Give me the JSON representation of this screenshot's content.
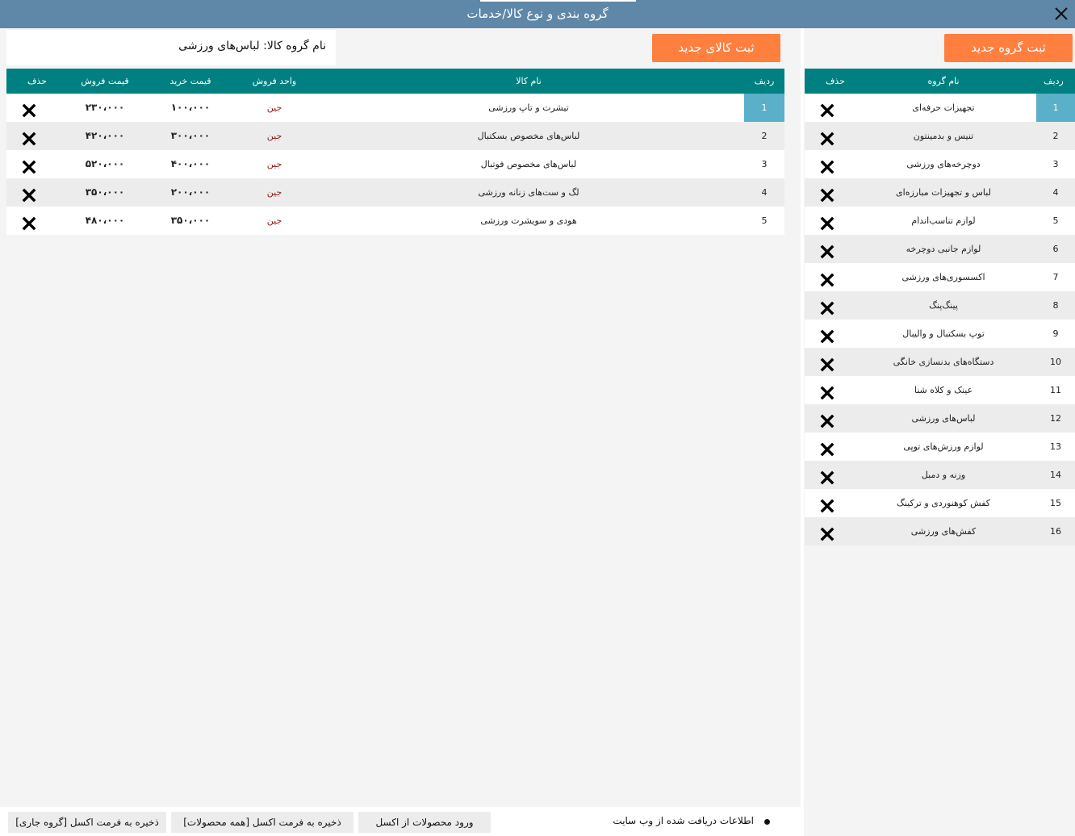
{
  "window": {
    "title": "گروه بندی و نوع کالا/خدمات"
  },
  "buttons": {
    "new_group": "ثبت گروه جدید",
    "new_product": "ثبت کالای جدید",
    "import_excel": "ورود محصولات از اکسل",
    "export_all": "ذخیره به فرمت اکسل [همه محصولات]",
    "export_current": "ذخیره به فرمت اکسل [گروه جاری]"
  },
  "current_group_label": "نام گروه کالا: لباس‌های ورزشی",
  "status": {
    "text": "اطلاعات دریافت شده از وب سایت"
  },
  "products": {
    "headers": {
      "row": "ردیف",
      "name": "نام کالا",
      "unit": "واحد فروش",
      "buy": "قیمت خرید",
      "sell": "قیمت فروش",
      "delete": "حذف"
    },
    "rows": [
      {
        "row": "1",
        "name": "تیشرت و تاپ ورزشی",
        "unit": "جین",
        "buy": "۱۰۰،۰۰۰",
        "sell": "۲۳۰،۰۰۰",
        "selected": true
      },
      {
        "row": "2",
        "name": "لباس‌های مخصوص بسکتبال",
        "unit": "جین",
        "buy": "۳۰۰،۰۰۰",
        "sell": "۴۲۰،۰۰۰"
      },
      {
        "row": "3",
        "name": "لباس‌های مخصوص فوتبال",
        "unit": "جین",
        "buy": "۴۰۰،۰۰۰",
        "sell": "۵۲۰،۰۰۰"
      },
      {
        "row": "4",
        "name": "لگ و ست‌های زنانه ورزشی",
        "unit": "جین",
        "buy": "۲۰۰،۰۰۰",
        "sell": "۳۵۰،۰۰۰"
      },
      {
        "row": "5",
        "name": "هودی و سویشرت ورزشی",
        "unit": "جین",
        "buy": "۳۵۰،۰۰۰",
        "sell": "۴۸۰،۰۰۰"
      }
    ]
  },
  "groups": {
    "headers": {
      "row": "ردیف",
      "name": "نام گروه",
      "delete": "حذف"
    },
    "rows": [
      {
        "row": "1",
        "name": "تجهیزات حرفه‌ای",
        "selected": true
      },
      {
        "row": "2",
        "name": "تنیس و بدمینتون"
      },
      {
        "row": "3",
        "name": "دوچرخه‌های ورزشی"
      },
      {
        "row": "4",
        "name": "لباس و تجهیزات مبارزه‌ای"
      },
      {
        "row": "5",
        "name": "لوازم تناسب‌اندام"
      },
      {
        "row": "6",
        "name": "لوازم جانبی دوچرخه"
      },
      {
        "row": "7",
        "name": "اکسسوری‌های ورزشی"
      },
      {
        "row": "8",
        "name": "پینگ‌پنگ"
      },
      {
        "row": "9",
        "name": "توپ بسکتبال و والیبال"
      },
      {
        "row": "10",
        "name": "دستگاه‌های بدنسازی خانگی"
      },
      {
        "row": "11",
        "name": "عینک و کلاه شنا"
      },
      {
        "row": "12",
        "name": "لباس‌های ورزشی"
      },
      {
        "row": "13",
        "name": "لوازم ورزش‌های توپی"
      },
      {
        "row": "14",
        "name": "وزنه و دمبل"
      },
      {
        "row": "15",
        "name": "کفش کوهنوردی و ترکینگ"
      },
      {
        "row": "16",
        "name": "کفش‌های ورزشی"
      }
    ]
  },
  "colors": {
    "titlebar": "#5f87a8",
    "header": "#008080",
    "accent_button": "#ff7f3f",
    "selected_cell": "#5aafc9",
    "unit_text": "#8b1a1a"
  },
  "icons": {
    "close": "close-icon",
    "delete": "delete-x-icon"
  }
}
